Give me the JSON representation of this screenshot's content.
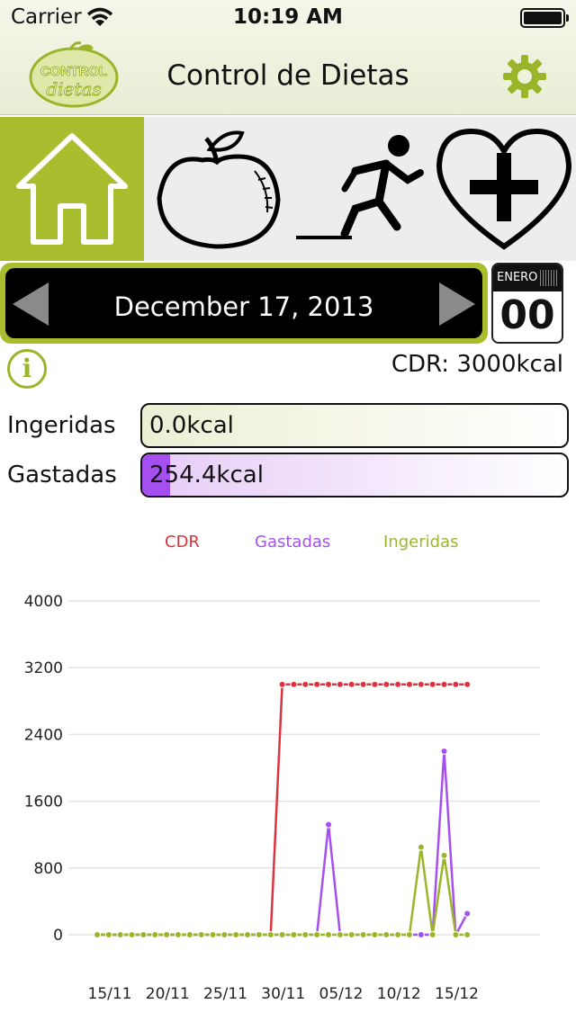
{
  "status": {
    "carrier": "Carrier",
    "time": "10:19 AM"
  },
  "nav": {
    "title": "Control de Dietas",
    "logo_icon": "control-dietas-logo",
    "settings_icon": "gear-icon"
  },
  "tabs": [
    {
      "name": "home",
      "icon": "home-icon",
      "active": true
    },
    {
      "name": "food",
      "icon": "apple-icon",
      "active": false
    },
    {
      "name": "exercise",
      "icon": "runner-icon",
      "active": false
    },
    {
      "name": "health",
      "icon": "heart-plus-icon",
      "active": false
    }
  ],
  "date_bar": {
    "date": "December 17, 2013"
  },
  "calendar": {
    "month": "ENERO",
    "day": "00"
  },
  "summary": {
    "cdr": "CDR: 3000kcal",
    "ingeridas_label": "Ingeridas",
    "ingeridas_value": "0.0kcal",
    "ingeridas_fraction": 0.0,
    "gastadas_label": "Gastadas",
    "gastadas_value": "254.4kcal",
    "gastadas_fraction": 0.065
  },
  "colors": {
    "accent": "#aabd2e",
    "cdr": "#d9343f",
    "gastadas": "#a64ff0",
    "ingeridas": "#9bb52a"
  },
  "chart_data": {
    "type": "line",
    "legend": [
      "CDR",
      "Gastadas",
      "Ingeridas"
    ],
    "x_tick_labels": [
      "15/11",
      "20/11",
      "25/11",
      "30/11",
      "05/12",
      "10/12",
      "15/12"
    ],
    "y_tick_labels": [
      "0",
      "800",
      "1600",
      "2400",
      "3200",
      "4000"
    ],
    "ylim": [
      0,
      4000
    ],
    "x_start": "15/11",
    "x": [
      "15/11",
      "16/11",
      "17/11",
      "18/11",
      "19/11",
      "20/11",
      "21/11",
      "22/11",
      "23/11",
      "24/11",
      "25/11",
      "26/11",
      "27/11",
      "28/11",
      "29/11",
      "30/11",
      "01/12",
      "02/12",
      "03/12",
      "04/12",
      "05/12",
      "06/12",
      "07/12",
      "08/12",
      "09/12",
      "10/12",
      "11/12",
      "12/12",
      "13/12",
      "14/12",
      "15/12",
      "16/12",
      "17/12"
    ],
    "series": [
      {
        "name": "CDR",
        "values": [
          0,
          0,
          0,
          0,
          0,
          0,
          0,
          0,
          0,
          0,
          0,
          0,
          0,
          0,
          0,
          0,
          3000,
          3000,
          3000,
          3000,
          3000,
          3000,
          3000,
          3000,
          3000,
          3000,
          3000,
          3000,
          3000,
          3000,
          3000,
          3000,
          3000
        ]
      },
      {
        "name": "Gastadas",
        "values": [
          0,
          0,
          0,
          0,
          0,
          0,
          0,
          0,
          0,
          0,
          0,
          0,
          0,
          0,
          0,
          0,
          0,
          0,
          0,
          0,
          1320,
          0,
          0,
          0,
          0,
          0,
          0,
          0,
          0,
          0,
          2200,
          0,
          254
        ]
      },
      {
        "name": "Ingeridas",
        "values": [
          0,
          0,
          0,
          0,
          0,
          0,
          0,
          0,
          0,
          0,
          0,
          0,
          0,
          0,
          0,
          0,
          0,
          0,
          0,
          0,
          0,
          0,
          0,
          0,
          0,
          0,
          0,
          0,
          1050,
          0,
          950,
          0,
          0
        ]
      }
    ]
  }
}
